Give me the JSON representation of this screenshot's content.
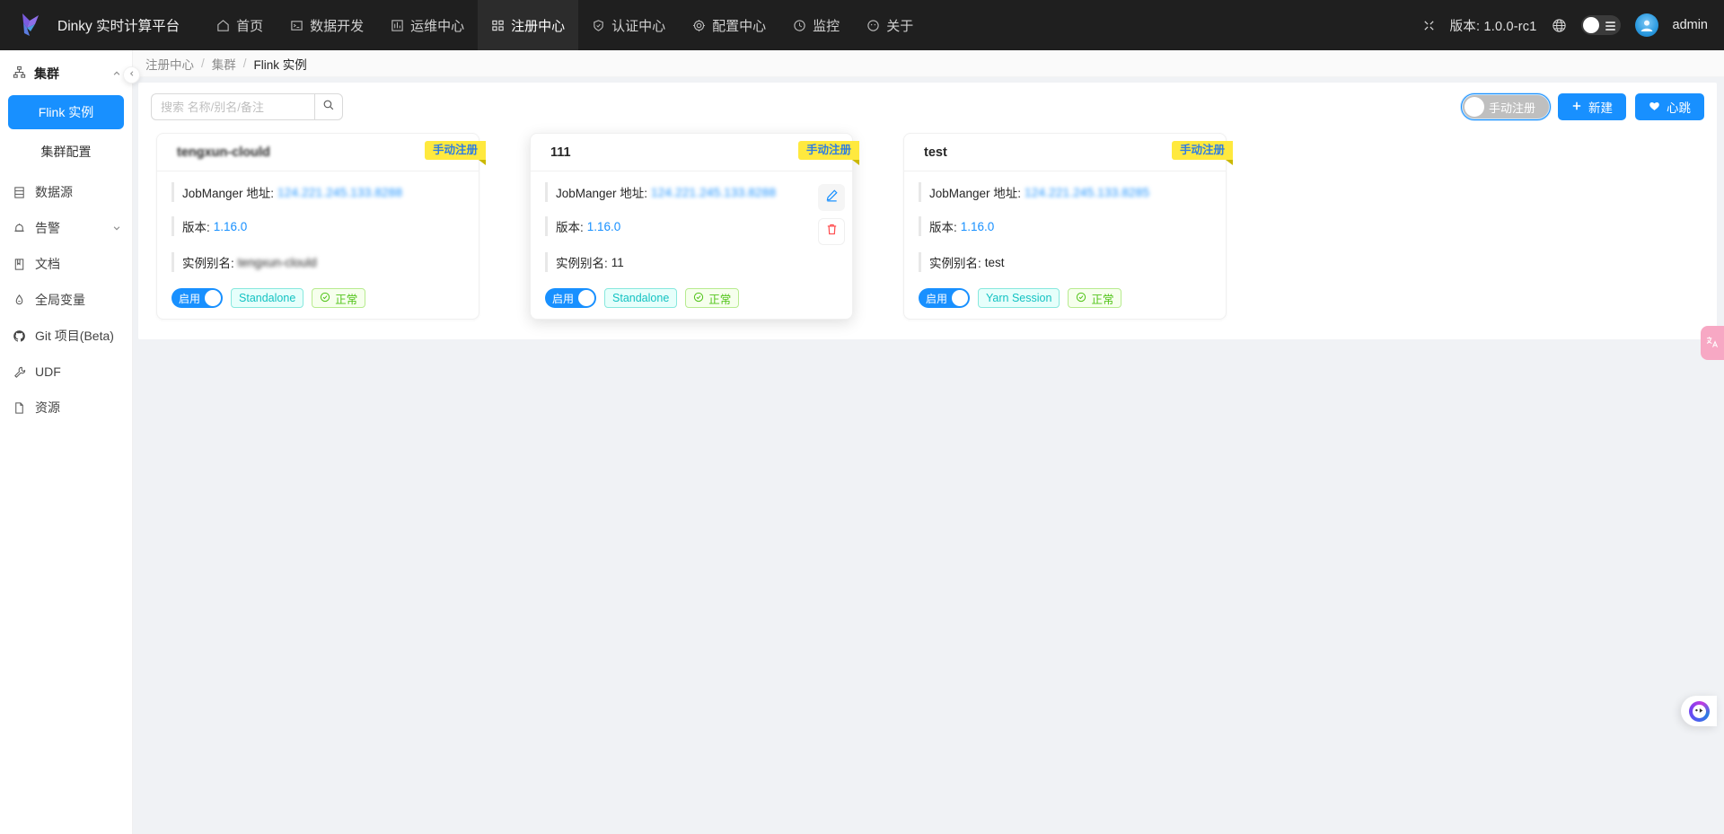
{
  "topnav": {
    "brand": "Dinky 实时计算平台",
    "items": [
      {
        "label": "首页",
        "icon": "home-icon",
        "active": false
      },
      {
        "label": "数据开发",
        "icon": "console-icon",
        "active": false
      },
      {
        "label": "运维中心",
        "icon": "ops-icon",
        "active": false
      },
      {
        "label": "注册中心",
        "icon": "registry-icon",
        "active": true
      },
      {
        "label": "认证中心",
        "icon": "shield-icon",
        "active": false
      },
      {
        "label": "配置中心",
        "icon": "gear-icon",
        "active": false
      },
      {
        "label": "监控",
        "icon": "monitor-icon",
        "active": false
      },
      {
        "label": "关于",
        "icon": "info-icon",
        "active": false
      }
    ],
    "fullscreen_icon": "fullscreen-icon",
    "version_label": "版本: 1.0.0-rc1",
    "language_icon": "globe-icon",
    "theme_toggle_icon": "theme-toggle",
    "avatar_icon": "avatar",
    "username": "admin"
  },
  "sidebar": {
    "group": {
      "label": "集群",
      "icon": "cluster-icon",
      "caret": "chevron-up-icon"
    },
    "subitems": [
      {
        "label": "Flink 实例",
        "selected": true
      },
      {
        "label": "集群配置",
        "selected": false
      }
    ],
    "items": [
      {
        "label": "数据源",
        "icon": "database-icon",
        "caret": ""
      },
      {
        "label": "告警",
        "icon": "alarm-icon",
        "caret": "chevron-down-icon"
      },
      {
        "label": "文档",
        "icon": "doc-icon",
        "caret": ""
      },
      {
        "label": "全局变量",
        "icon": "variable-icon",
        "caret": ""
      },
      {
        "label": "Git 项目(Beta)",
        "icon": "github-icon",
        "caret": ""
      },
      {
        "label": "UDF",
        "icon": "wrench-icon",
        "caret": ""
      },
      {
        "label": "资源",
        "icon": "file-icon",
        "caret": ""
      }
    ],
    "collapse_icon": "chevron-left-icon"
  },
  "breadcrumb": {
    "items": [
      "注册中心",
      "集群",
      "Flink 实例"
    ],
    "separator": "/"
  },
  "toolbar": {
    "search_value": "",
    "search_placeholder": "搜索 名称/别名/备注",
    "search_icon": "search-icon",
    "register_switch_label": "手动注册",
    "register_switch_on": false,
    "new_button_label": "新建",
    "new_button_icon": "plus-icon",
    "heartbeat_button_label": "心跳",
    "heartbeat_button_icon": "heart-icon"
  },
  "labels": {
    "jobmanager": "JobManger 地址:",
    "version": "版本:",
    "alias": "实例别名:",
    "enabled_switch": "启用",
    "status_icon": "check-circle-icon",
    "edit_icon": "edit-pencil-icon",
    "delete_icon": "trash-icon"
  },
  "cards": [
    {
      "title": "tengxun-clould",
      "ribbon": "手动注册",
      "jobmanager_address": "124.221.245.133.8288",
      "address_blurred": true,
      "version": "1.16.0",
      "alias": "tengxun-clould",
      "alias_blurred": true,
      "enabled": true,
      "type_tag": "Standalone",
      "status_tag": "正常",
      "hovered": false
    },
    {
      "title": "111",
      "ribbon": "手动注册",
      "jobmanager_address": "124.221.245.133.8288",
      "address_blurred": true,
      "version": "1.16.0",
      "alias": "11",
      "alias_blurred": false,
      "enabled": true,
      "type_tag": "Standalone",
      "status_tag": "正常",
      "hovered": true
    },
    {
      "title": "test",
      "ribbon": "手动注册",
      "jobmanager_address": "124.221.245.133.8285",
      "address_blurred": true,
      "version": "1.16.0",
      "alias": "test",
      "alias_blurred": false,
      "enabled": true,
      "type_tag": "Yarn Session",
      "status_tag": "正常",
      "hovered": false
    }
  ],
  "floating": {
    "translate_icon": "translate-icon",
    "translate_label": "中A",
    "assistant_icon": "assistant-orb-icon"
  },
  "colors": {
    "accent": "#1890ff",
    "nav_bg": "#1f1f1f",
    "ribbon_bg": "#ffe93e",
    "ribbon_text": "#2f7de1",
    "tag_cyan": "#13c2c2",
    "tag_green": "#52c41a",
    "danger": "#ff4d4f"
  }
}
